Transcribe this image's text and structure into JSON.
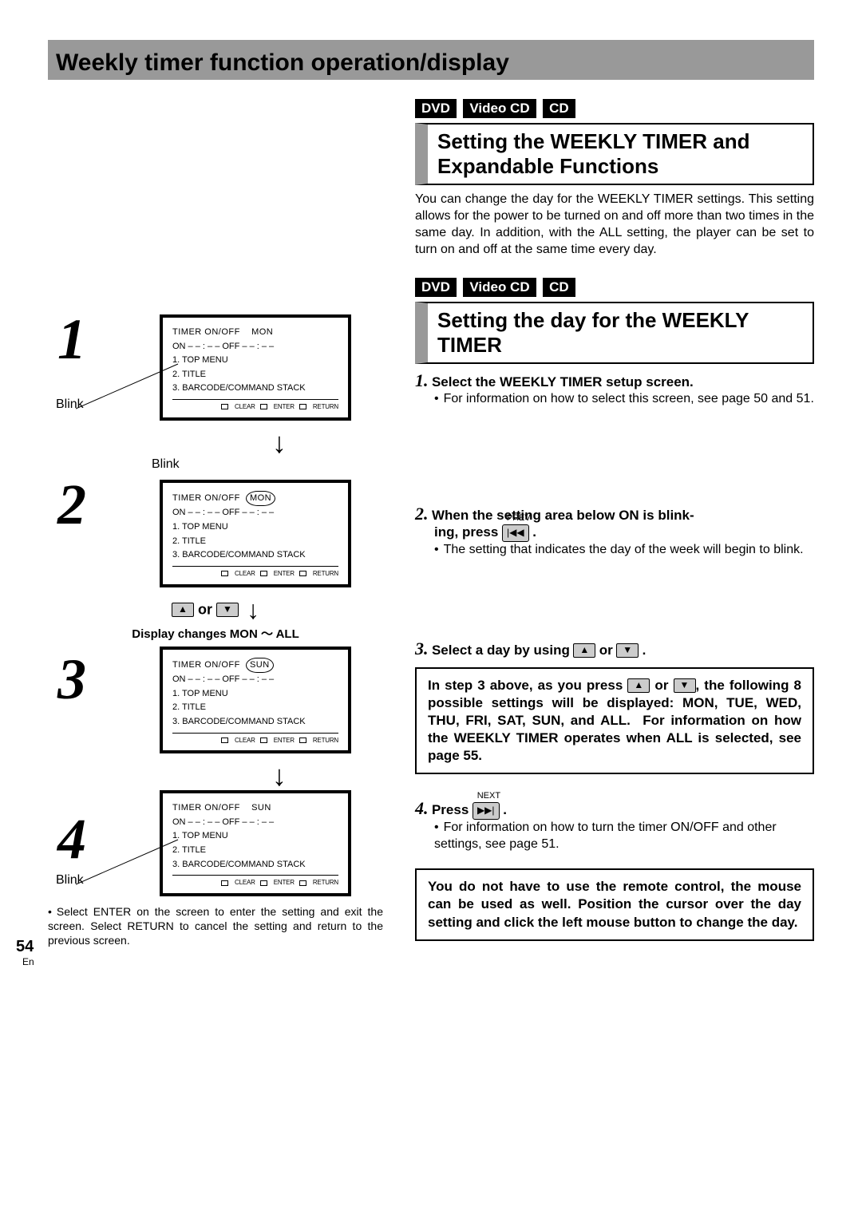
{
  "banner": {
    "title": "Weekly timer function operation/display"
  },
  "media": {
    "dvd": "DVD",
    "vcd": "Video CD",
    "cd": "CD"
  },
  "sec1": {
    "title": "Setting the WEEKLY TIMER and Expandable Functions",
    "body": "You can change the day for the WEEKLY TIMER settings. This setting allows for the power to be turned on and off more than two times in the same day. In addition, with the ALL setting, the player can be set to turn on and off at the same time every day."
  },
  "sec2": {
    "title": "Setting the day for the WEEKLY TIMER"
  },
  "steps": {
    "s1": {
      "num": "1.",
      "heading": "Select the WEEKLY TIMER setup screen.",
      "body": "For information on how to select this screen, see page 50 and 51."
    },
    "s2": {
      "num": "2.",
      "heading_a": "When the setting area below ON is blink-",
      "heading_b": "ing, press",
      "prev_label": "PREV",
      "body": "The setting that indicates the day of the week will begin to blink."
    },
    "s3": {
      "num": "3.",
      "heading": "Select a day by using",
      "heading_or": "or",
      "heading_dot": ".",
      "box": "In step 3 above, as you press ▲ or ▼, the following 8 possible settings will be displayed: MON, TUE, WED, THU, FRI, SAT, SUN, and ALL.  For information on how the WEEKLY TIMER operates when ALL is selected, see page 55."
    },
    "s4": {
      "num": "4.",
      "heading": "Press",
      "next_label": "NEXT",
      "body": "For information on how to turn the timer ON/OFF and other settings, see page 51."
    },
    "final_box": "You do not have to use the remote control, the mouse can be used as well.  Position the cursor over the day setting and click the left mouse button to change the day."
  },
  "diag": {
    "header": "TIMER ON/OFF",
    "day_mon": "MON",
    "day_sun": "SUN",
    "onoff": "ON – – : – –    OFF – – : – –",
    "menu1": "1. TOP MENU",
    "menu2": "2. TITLE",
    "menu3": "3. BARCODE/COMMAND STACK",
    "ftr_clear": "CLEAR",
    "ftr_enter": "ENTER",
    "ftr_return": "RETURN",
    "blink": "Blink",
    "or": "or",
    "changes": "Display changes MON ～ ALL"
  },
  "left_footer": "Select ENTER on the screen to enter the setting and exit the screen. Select RETURN to cancel the setting and return to the previous screen.",
  "page_num": "54",
  "page_lang": "En"
}
